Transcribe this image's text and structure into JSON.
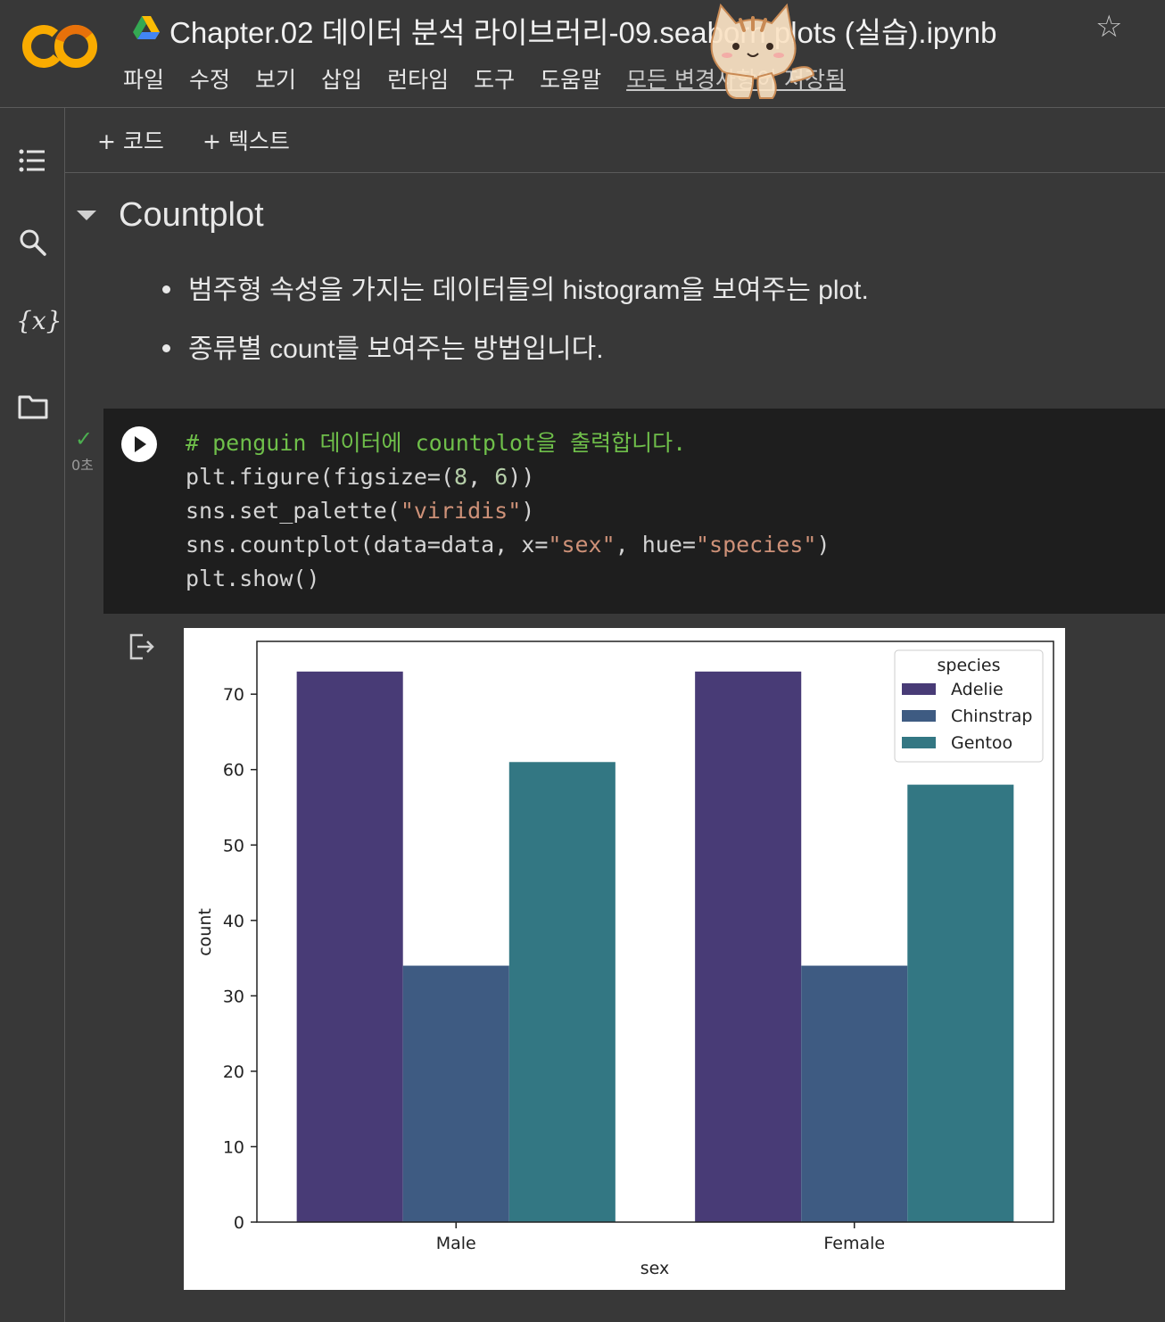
{
  "header": {
    "title": "Chapter.02 데이터 분석 라이브러리-09.seaborn plots (실습).ipynb",
    "logo_text": "CO",
    "menu": [
      "파일",
      "수정",
      "보기",
      "삽입",
      "런타임",
      "도구",
      "도움말"
    ],
    "save_status": "모든 변경사항이 저장됨"
  },
  "sidebar": {
    "icons": [
      "table-of-contents-icon",
      "search-icon",
      "variables-icon",
      "folder-icon"
    ],
    "variables_label": "{x}"
  },
  "toolbar": {
    "add_code": "+ 코드",
    "add_text": "+ 텍스트"
  },
  "text_cell": {
    "heading": "Countplot",
    "bullets": [
      "범주형 속성을 가지는 데이터들의 histogram을 보여주는 plot.",
      "종류별 count를 보여주는 방법입니다."
    ]
  },
  "code_cell": {
    "exec_time": "0초",
    "lines": {
      "comment": "# penguin 데이터에 countplot을 출력합니다.",
      "l2_a": "plt.figure(figsize=(",
      "l2_n1": "8",
      "l2_b": ", ",
      "l2_n2": "6",
      "l2_c": "))",
      "l3_a": "sns.set_palette(",
      "l3_s": "\"viridis\"",
      "l3_b": ")",
      "l4_a": "sns.countplot(data=data, x=",
      "l4_s1": "\"sex\"",
      "l4_b": ", hue=",
      "l4_s2": "\"species\"",
      "l4_c": ")",
      "l5": "plt.show()"
    }
  },
  "colors": {
    "adelie": "#483b76",
    "chinstrap": "#3e5b82",
    "gentoo": "#337783"
  },
  "chart_data": {
    "type": "bar",
    "categories": [
      "Male",
      "Female"
    ],
    "series": [
      {
        "name": "Adelie",
        "values": [
          73,
          73
        ]
      },
      {
        "name": "Chinstrap",
        "values": [
          34,
          34
        ]
      },
      {
        "name": "Gentoo",
        "values": [
          61,
          58
        ]
      }
    ],
    "xlabel": "sex",
    "ylabel": "count",
    "ylim": [
      0,
      77
    ],
    "yticks": [
      0,
      10,
      20,
      30,
      40,
      50,
      60,
      70
    ],
    "legend_title": "species",
    "legend_position": "top-right",
    "grid": false
  }
}
